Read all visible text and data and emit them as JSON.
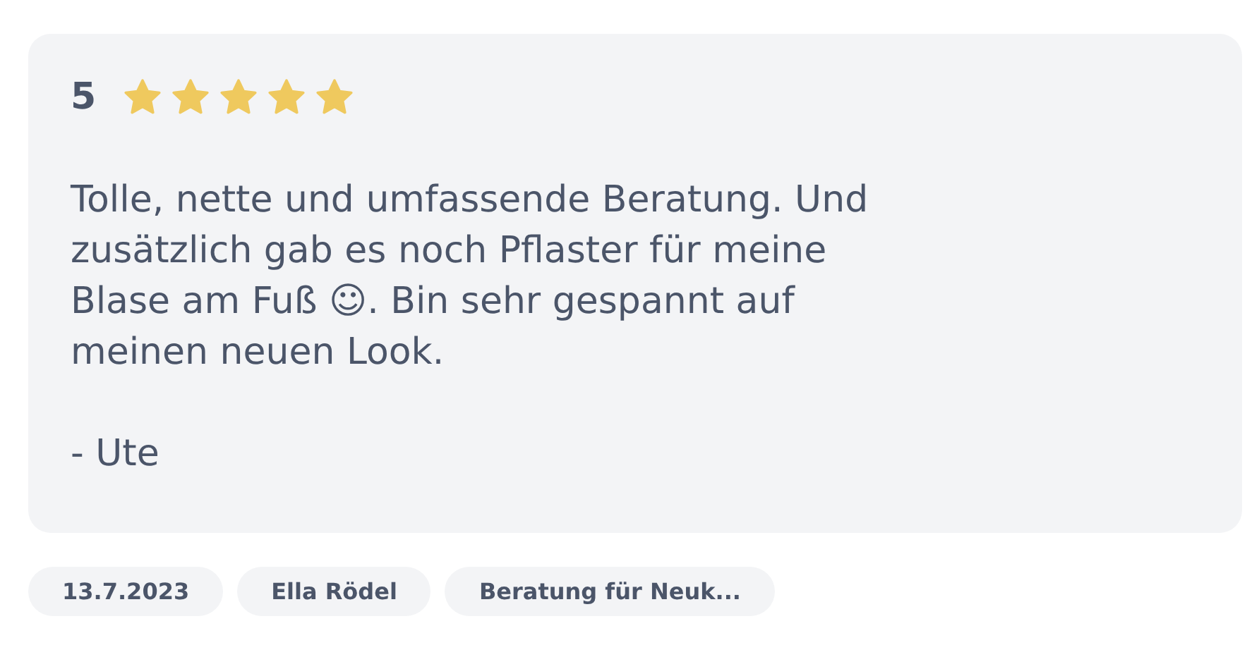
{
  "review": {
    "score": "5",
    "stars": 5,
    "text": "Tolle, nette und umfassende Beratung. Und\nzusätzlich gab es noch Pflaster für meine\nBlase am Fuß ☺. Bin sehr gespannt auf\nmeinen neuen Look.",
    "author": "- Ute"
  },
  "tags": [
    "13.7.2023",
    "Ella Rödel",
    "Beratung für Neuk..."
  ]
}
